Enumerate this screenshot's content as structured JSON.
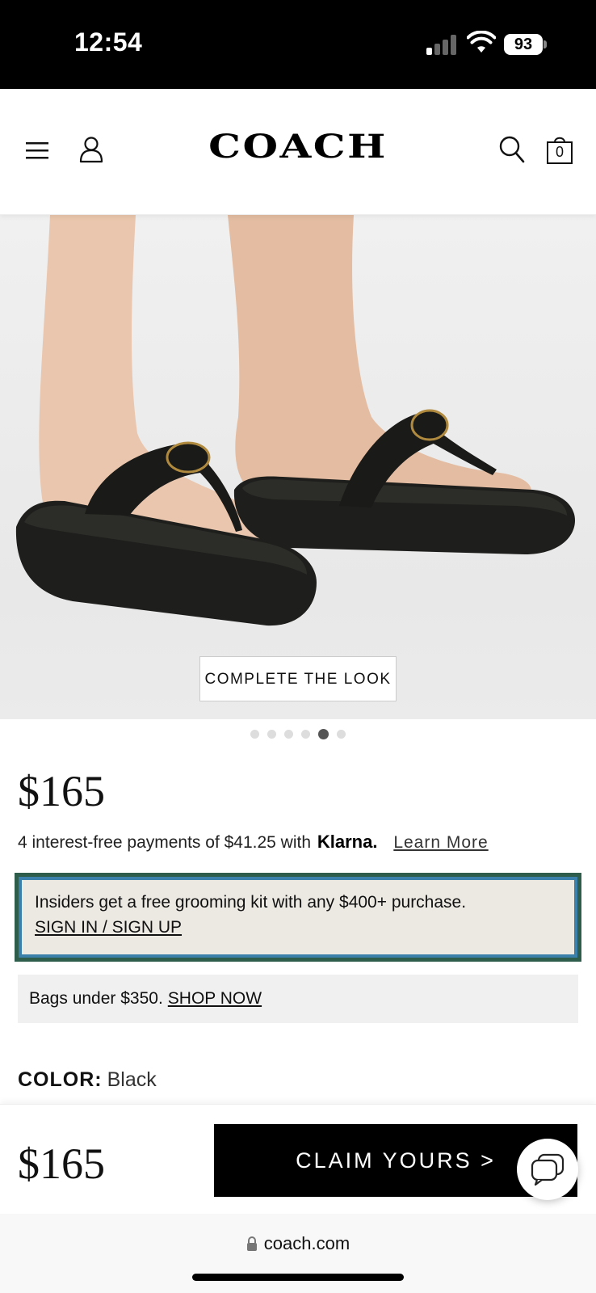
{
  "status_bar": {
    "time": "12:54",
    "battery": "93"
  },
  "header": {
    "logo": "COACH",
    "bag_count": "0"
  },
  "hero": {
    "complete_look_label": "COMPLETE THE LOOK",
    "carousel_total": 6,
    "carousel_active_index": 5
  },
  "product": {
    "price": "$165",
    "klarna": {
      "prefix": "4 interest-free payments of $41.25 with",
      "brand": "Klarna.",
      "link": "Learn More"
    },
    "insiders": {
      "text": "Insiders get a free grooming kit with any $400+ purchase.",
      "link": "SIGN IN / SIGN UP"
    },
    "bags_banner": {
      "text": "Bags under $350.",
      "link": "SHOP NOW"
    },
    "color": {
      "label": "COLOR:",
      "value": "Black"
    }
  },
  "sticky": {
    "price": "$165",
    "cta": "CLAIM YOURS >"
  },
  "browser": {
    "url": "coach.com"
  },
  "colors": {
    "insiders_outer": "#2e5d4b",
    "insiders_inner": "#3b7fab",
    "insiders_bg": "#ece8e2"
  }
}
